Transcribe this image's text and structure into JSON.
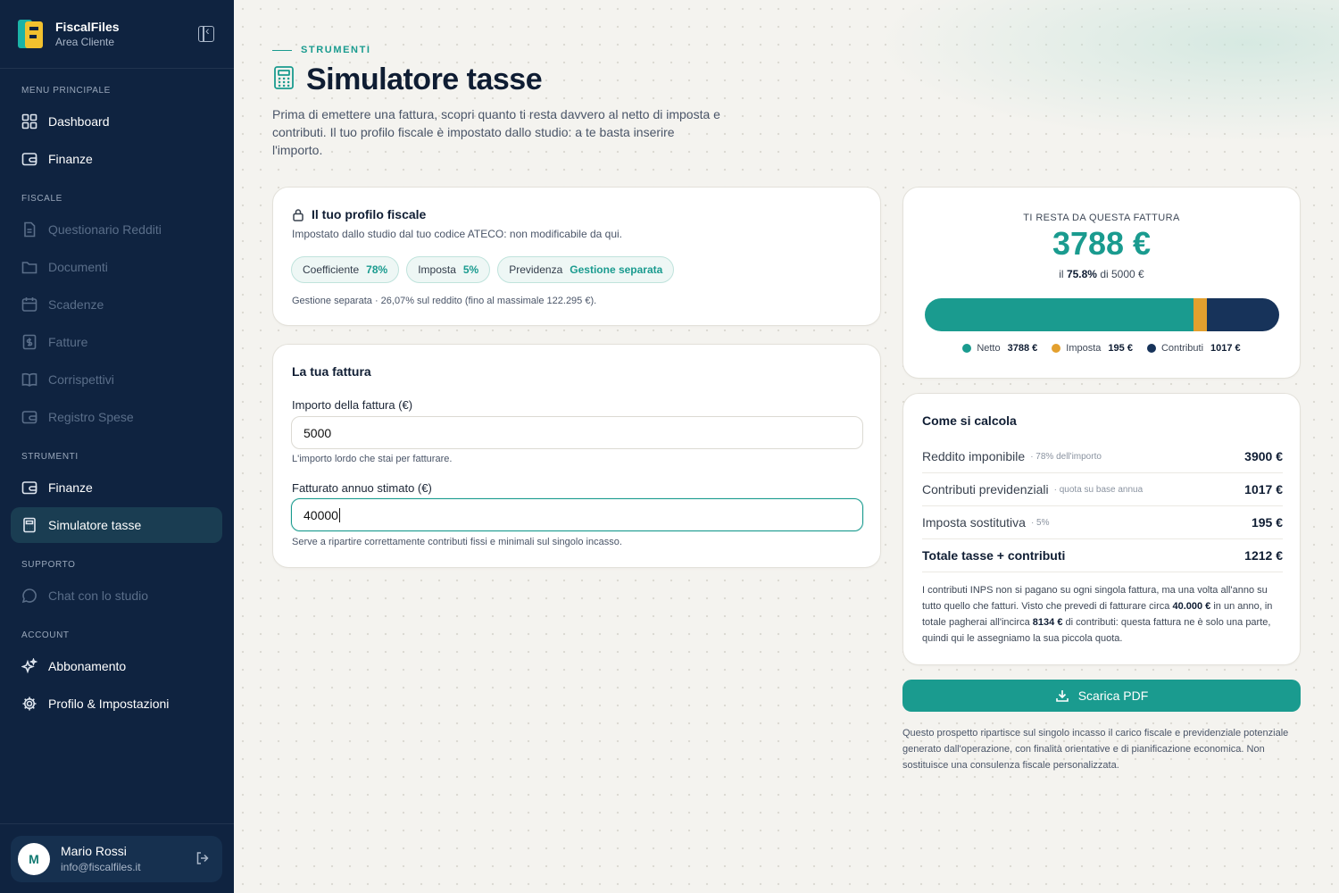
{
  "brand": {
    "name": "FiscalFiles",
    "subtitle": "Area Cliente"
  },
  "sidebar": {
    "sections": {
      "main": "MENU PRINCIPALE",
      "fiscal": "FISCALE",
      "tools": "STRUMENTI",
      "support": "SUPPORTO",
      "account": "ACCOUNT"
    },
    "items": [
      {
        "label": "Dashboard",
        "icon": "dashboard-grid-icon",
        "state": "enabled"
      },
      {
        "label": "Finanze",
        "icon": "wallet-icon",
        "state": "enabled"
      },
      {
        "label": "Questionario Redditi",
        "icon": "document-icon",
        "state": "disabled"
      },
      {
        "label": "Documenti",
        "icon": "folder-icon",
        "state": "disabled"
      },
      {
        "label": "Scadenze",
        "icon": "calendar-icon",
        "state": "disabled"
      },
      {
        "label": "Fatture",
        "icon": "invoice-icon",
        "state": "disabled"
      },
      {
        "label": "Corrispettivi",
        "icon": "book-icon",
        "state": "disabled"
      },
      {
        "label": "Registro Spese",
        "icon": "wallet-icon",
        "state": "disabled"
      },
      {
        "label": "Finanze",
        "icon": "wallet-icon",
        "state": "enabled"
      },
      {
        "label": "Simulatore tasse",
        "icon": "calculator-icon",
        "state": "active"
      },
      {
        "label": "Chat con lo studio",
        "icon": "chat-icon",
        "state": "disabled"
      },
      {
        "label": "Abbonamento",
        "icon": "sparkles-icon",
        "state": "enabled"
      },
      {
        "label": "Profilo & Impostazioni",
        "icon": "gear-icon",
        "state": "enabled"
      }
    ],
    "user": {
      "initial": "M",
      "name": "Mario Rossi",
      "email": "info@fiscalfiles.it"
    }
  },
  "header": {
    "eyebrow": "STRUMENTI",
    "title": "Simulatore tasse",
    "intro": "Prima di emettere una fattura, scopri quanto ti resta davvero al netto di imposta e contributi. Il tuo profilo fiscale è impostato dallo studio: a te basta inserire l'importo."
  },
  "profile": {
    "title": "Il tuo profilo fiscale",
    "subtitle": "Impostato dallo studio dal tuo codice ATECO: non modificabile da qui.",
    "pills": [
      {
        "label": "Coefficiente",
        "value": "78%"
      },
      {
        "label": "Imposta",
        "value": "5%"
      },
      {
        "label": "Previdenza",
        "value": "Gestione separata"
      }
    ],
    "note": "Gestione separata · 26,07% sul reddito (fino al massimale 122.295 €)."
  },
  "invoice": {
    "title": "La tua fattura",
    "amount_label": "Importo della fattura (€)",
    "amount_value": "5000",
    "amount_help": "L'importo lordo che stai per fatturare.",
    "annual_label": "Fatturato annuo stimato (€)",
    "annual_value": "40000",
    "annual_help": "Serve a ripartire correttamente contributi fissi e minimali sul singolo incasso."
  },
  "result": {
    "label": "TI RESTA DA QUESTA FATTURA",
    "value": "3788 €",
    "share_prefix": "il",
    "share_pct": "75.8%",
    "share_suffix": "di 5000 €",
    "breakdown": [
      {
        "name": "Netto",
        "value": 3788,
        "display": "3788 €",
        "color": "#1a9b8f"
      },
      {
        "name": "Imposta",
        "value": 195,
        "display": "195 €",
        "color": "#e3a02e"
      },
      {
        "name": "Contributi",
        "value": 1017,
        "display": "1017 €",
        "color": "#17335a"
      }
    ]
  },
  "calc": {
    "title": "Come si calcola",
    "rows": [
      {
        "label": "Reddito imponibile",
        "note": "· 78% dell'importo",
        "value": "3900 €"
      },
      {
        "label": "Contributi previdenziali",
        "note": "· quota su base annua",
        "value": "1017 €"
      },
      {
        "label": "Imposta sostitutiva",
        "note": "· 5%",
        "value": "195 €"
      },
      {
        "label": "Totale tasse + contributi",
        "note": "",
        "value": "1212 €"
      }
    ],
    "text_1": "I contributi INPS non si pagano su ogni singola fattura, ma una volta all'anno su tutto quello che fatturi. Visto che prevedi di fatturare circa",
    "text_bold_1": "40.000 €",
    "text_2": "in un anno, in totale pagherai all'incirca",
    "text_bold_2": "8134 €",
    "text_3": "di contributi: questa fattura ne è solo una parte, quindi qui le assegniamo la sua piccola quota."
  },
  "pdf_button": "Scarica PDF",
  "disclaimer": "Questo prospetto ripartisce sul singolo incasso il carico fiscale e previdenziale potenziale generato dall'operazione, con finalità orientative e di pianificazione economica. Non sostituisce una consulenza fiscale personalizzata."
}
